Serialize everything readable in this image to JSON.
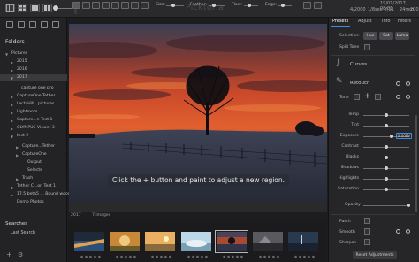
{
  "app": {
    "title": "Picktorial",
    "date": "19/01/2017, 08:01",
    "meta": [
      "4/2000",
      "1/8sec",
      "f/11",
      "24mm",
      "200"
    ]
  },
  "sidebar": {
    "folders_heading": "Folders",
    "tree": [
      {
        "label": "Pictures"
      },
      {
        "label": "2015"
      },
      {
        "label": "2016"
      },
      {
        "label": "2017"
      },
      {
        "label": "capture one pro"
      },
      {
        "label": "CaptureOne Tether"
      },
      {
        "label": "Lech Hill...pictures"
      },
      {
        "label": "Lightroom"
      },
      {
        "label": "Capture...n Test 1"
      },
      {
        "label": "OLYMPUS Viewer 3"
      },
      {
        "label": "test 2"
      },
      {
        "label": "Capture...Tether"
      },
      {
        "label": "CaptureOne"
      },
      {
        "label": "Output"
      },
      {
        "label": "Selects"
      },
      {
        "label": "Trash"
      },
      {
        "label": "Tether C...on Test 1"
      },
      {
        "label": "17.5 beta5 ... Bound wood"
      },
      {
        "label": "Demo Photos"
      }
    ],
    "searches_heading": "Searches",
    "last_search": "Last Search",
    "add_label": "+",
    "settings_label": "⚙"
  },
  "photo": {
    "hint": "Click the + button and paint to adjust a new region."
  },
  "toolbar": {
    "size_label": "Size:",
    "feather_label": "Feather:",
    "flow_label": "Flow:",
    "edge_label": "Edge:"
  },
  "filmstrip": {
    "folder": "2017",
    "count": "7 images"
  },
  "panel": {
    "tabs": [
      "Presets",
      "Adjust",
      "Info",
      "Filters"
    ],
    "selection_label": "Selection:",
    "seg_buttons": [
      "Hue",
      "Sat",
      "Luma"
    ],
    "split_tone_label": "Split Tone",
    "curves_title": "Curves",
    "retouch_title": "Retouch",
    "tone_label": "Tone",
    "adjustments": [
      {
        "label": "Temp",
        "value": 0.5
      },
      {
        "label": "Tint",
        "value": 0.5
      },
      {
        "label": "Exposure",
        "value": 0.62,
        "readout": "0.00EV"
      },
      {
        "label": "Contrast",
        "value": 0.5
      },
      {
        "label": "Blacks",
        "value": 0.5
      },
      {
        "label": "Shadows",
        "value": 0.5
      },
      {
        "label": "Highlights",
        "value": 0.5
      },
      {
        "label": "Saturation",
        "value": 0.5
      }
    ],
    "opacity_label": "Opacity",
    "patch_label": "Patch",
    "smooth_label": "Smooth",
    "sharpen_label": "Sharpen",
    "reset_label": "Reset Adjustments"
  },
  "colors": {
    "accent": "#3d8ee0",
    "sky_orange": "#d8542a"
  }
}
